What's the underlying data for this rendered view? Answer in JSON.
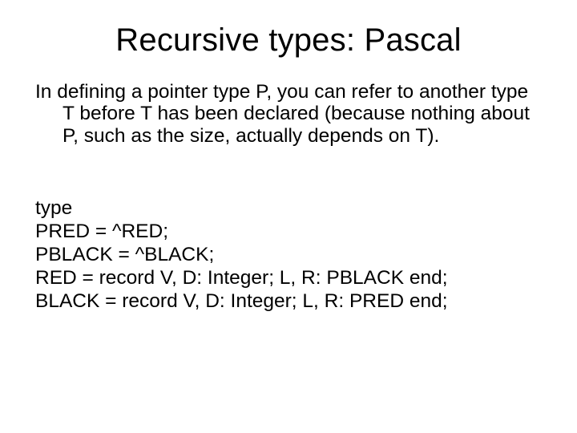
{
  "title": "Recursive types: Pascal",
  "paragraph": "In defining a pointer type P, you can refer to another type T before T has been declared (because nothing about P, such as the size, actually depends on T).",
  "code": {
    "l1": "type",
    "l2": "PRED = ^RED;",
    "l3": "PBLACK = ^BLACK;",
    "l4": "RED = record V, D: Integer; L, R: PBLACK end;",
    "l5": "BLACK = record V, D: Integer; L, R: PRED end;"
  }
}
